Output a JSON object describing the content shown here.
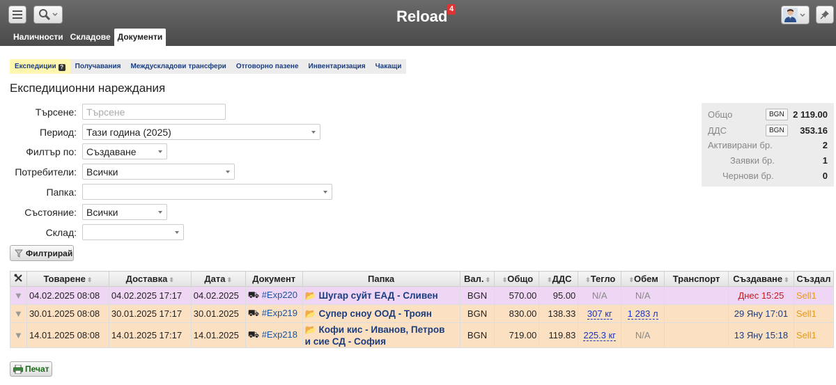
{
  "app": {
    "title": "Reload",
    "badge": "4"
  },
  "main_tabs": [
    "Наличности",
    "Складове",
    "Документи"
  ],
  "sub_tabs": [
    "Експедиции",
    "Получавания",
    "Междускладови трансфери",
    "Отговорно пазене",
    "Инвентаризация",
    "Чакащи"
  ],
  "page_title": "Експедиционни нареждания",
  "form": {
    "search_label": "Търсене:",
    "search_placeholder": "Търсене",
    "period_label": "Период:",
    "period_value": "Тази година (2025)",
    "filter_by_label": "Филтър по:",
    "filter_by_value": "Създаване",
    "users_label": "Потребители:",
    "users_value": "Всички",
    "folder_label": "Папка:",
    "folder_value": "",
    "state_label": "Състояние:",
    "state_value": "Всички",
    "warehouse_label": "Склад:",
    "warehouse_value": "",
    "filter_button": "Филтрирай"
  },
  "summary": {
    "total_label": "Общо",
    "total_currency": "BGN",
    "total_value": "2 119.00",
    "vat_label": "ДДС",
    "vat_currency": "BGN",
    "vat_value": "353.16",
    "activated_label": "Активирани бр.",
    "activated_value": "2",
    "requests_label": "Заявки бр.",
    "requests_value": "1",
    "drafts_label": "Чернови бр.",
    "drafts_value": "0"
  },
  "table": {
    "headers": {
      "loading": "Товарене",
      "delivery": "Доставка",
      "date": "Дата",
      "document": "Документ",
      "folder": "Папка",
      "currency": "Вал.",
      "total": "Общо",
      "vat": "ДДС",
      "weight": "Тегло",
      "volume": "Обем",
      "transport": "Транспорт",
      "created": "Създаване",
      "created_by": "Създал"
    },
    "rows": [
      {
        "loading": "04.02.2025 08:08",
        "delivery": "04.02.2025 17:17",
        "date": "04.02.2025",
        "document": "#Exp220",
        "folder": "Шугар суйт ЕАД - Сливен",
        "folder2": "",
        "currency": "BGN",
        "total": "570.00",
        "vat": "95.00",
        "weight": "N/A",
        "volume": "N/A",
        "transport": "",
        "created": "Днес 15:25",
        "created_by": "Sell1"
      },
      {
        "loading": "30.01.2025 08:08",
        "delivery": "30.01.2025 17:17",
        "date": "30.01.2025",
        "document": "#Exp219",
        "folder": "Супер сноу ООД - Троян",
        "folder2": "",
        "currency": "BGN",
        "total": "830.00",
        "vat": "138.33",
        "weight": "307 кг",
        "volume": "1 283 л",
        "transport": "",
        "created": "29 Яну 17:01",
        "created_by": "Sell1"
      },
      {
        "loading": "14.01.2025 08:08",
        "delivery": "14.01.2025 17:17",
        "date": "14.01.2025",
        "document": "#Exp218",
        "folder": "Кофи кис - Иванов, Петров",
        "folder2": "и сие СД - София",
        "currency": "BGN",
        "total": "719.00",
        "vat": "119.83",
        "weight": "225.3 кг",
        "volume": "N/A",
        "transport": "",
        "created": "13 Яну 15:18",
        "created_by": "Sell1"
      }
    ]
  },
  "print_button": "Печат"
}
